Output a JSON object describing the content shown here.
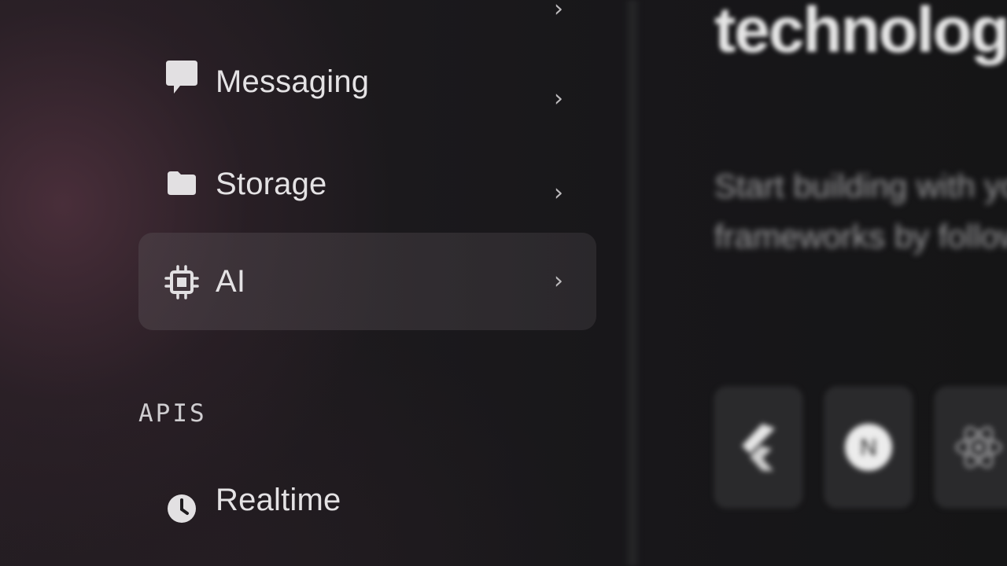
{
  "sidebar": {
    "items": [
      {
        "label": "",
        "icon": "partial-item-icon",
        "partial": true
      },
      {
        "label": "Messaging",
        "icon": "chat-bubble-icon"
      },
      {
        "label": "Storage",
        "icon": "folder-icon"
      },
      {
        "label": "AI",
        "icon": "chip-icon",
        "active": true
      }
    ],
    "chevron": "›",
    "section_apis": "APIS",
    "api_items": [
      {
        "label": "Realtime",
        "icon": "clock-icon"
      }
    ]
  },
  "content": {
    "title": "technologie",
    "description_lines": [
      "Start building with you",
      "frameworks by followi"
    ],
    "frameworks": [
      {
        "icon": "flutter-icon"
      },
      {
        "icon": "nextjs-icon",
        "glyph": "N"
      },
      {
        "icon": "react-icon"
      }
    ]
  },
  "colors": {
    "active_item_bg": "#4a4248",
    "text_primary": "#e4e2e4",
    "accent_background": "#231d22"
  }
}
